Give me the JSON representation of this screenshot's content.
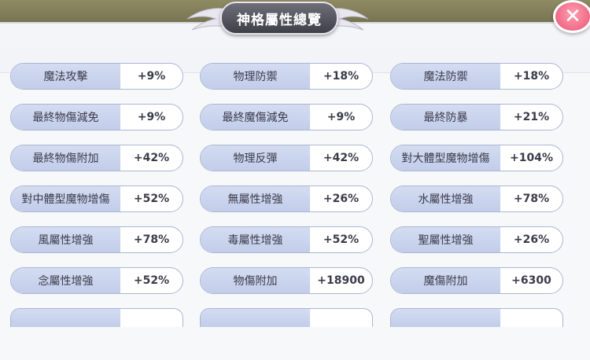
{
  "window": {
    "title": "神格屬性總覽",
    "close_label": "✕"
  },
  "stats": [
    [
      {
        "name": "魔法攻擊",
        "value": "+9%"
      },
      {
        "name": "物理防禦",
        "value": "+18%"
      },
      {
        "name": "魔法防禦",
        "value": "+18%"
      }
    ],
    [
      {
        "name": "最終物傷減免",
        "value": "+9%"
      },
      {
        "name": "最終魔傷減免",
        "value": "+9%"
      },
      {
        "name": "最終防暴",
        "value": "+21%"
      }
    ],
    [
      {
        "name": "最終物傷附加",
        "value": "+42%"
      },
      {
        "name": "物理反彈",
        "value": "+42%"
      },
      {
        "name": "對大體型魔物增傷",
        "value": "+104%"
      }
    ],
    [
      {
        "name": "對中體型魔物增傷",
        "value": "+52%"
      },
      {
        "name": "無屬性增強",
        "value": "+26%"
      },
      {
        "name": "水屬性增強",
        "value": "+78%"
      }
    ],
    [
      {
        "name": "風屬性增強",
        "value": "+78%"
      },
      {
        "name": "毒屬性增強",
        "value": "+52%"
      },
      {
        "name": "聖屬性增強",
        "value": "+26%"
      }
    ],
    [
      {
        "name": "念屬性增強",
        "value": "+52%"
      },
      {
        "name": "物傷附加",
        "value": "+18900"
      },
      {
        "name": "魔傷附加",
        "value": "+6300"
      }
    ]
  ],
  "colors": {
    "accent_close": "#f06a86",
    "pill_label_bg": "#c9d3ee",
    "title_bg": "#4a4a54"
  }
}
